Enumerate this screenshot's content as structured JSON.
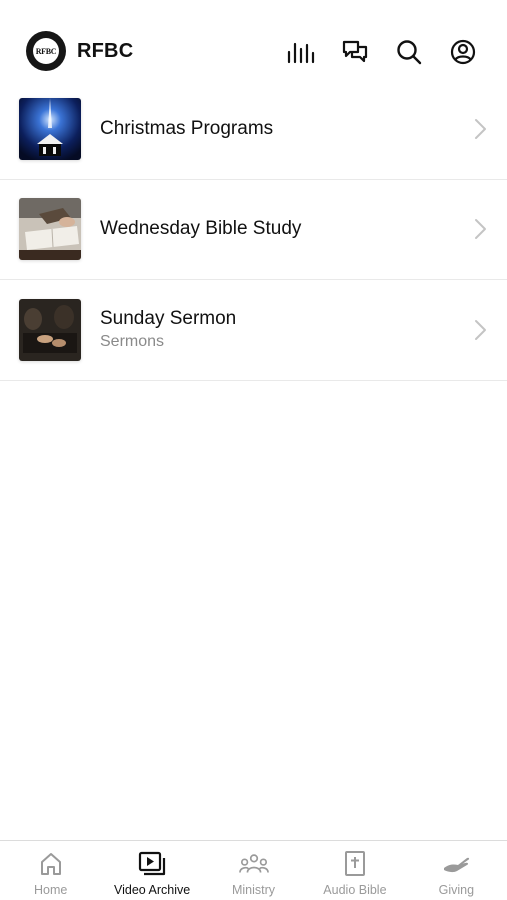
{
  "header": {
    "logo_text": "RFBC",
    "brand": "RFBC",
    "icons": [
      "equalizer-icon",
      "chat-icon",
      "search-icon",
      "account-icon"
    ]
  },
  "list": {
    "items": [
      {
        "title": "Christmas Programs",
        "subtitle": "",
        "thumb": "christmas-thumbnail"
      },
      {
        "title": "Wednesday Bible Study",
        "subtitle": "",
        "thumb": "bible-study-thumbnail"
      },
      {
        "title": "Sunday Sermon",
        "subtitle": "Sermons",
        "thumb": "sermon-thumbnail"
      }
    ]
  },
  "tabbar": {
    "active": "Video Archive",
    "tabs": [
      {
        "label": "Home",
        "icon": "home-icon"
      },
      {
        "label": "Video Archive",
        "icon": "video-library-icon"
      },
      {
        "label": "Ministry",
        "icon": "group-icon"
      },
      {
        "label": "Audio Bible",
        "icon": "bible-icon"
      },
      {
        "label": "Giving",
        "icon": "giving-hand-icon"
      }
    ]
  },
  "colors": {
    "active": "#111111",
    "inactive": "#9a9a9a",
    "divider": "#e9e9e9"
  }
}
